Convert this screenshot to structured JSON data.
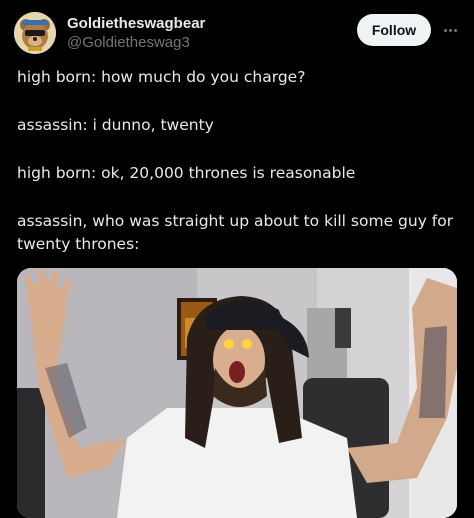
{
  "author": {
    "display_name": "Goldietheswagbear",
    "handle": "@Goldietheswag3",
    "avatar_icon": "bear-avatar-icon"
  },
  "actions": {
    "follow_label": "Follow",
    "more_icon": "more-options-icon"
  },
  "tweet": {
    "lines": [
      "high born: how much do you charge?",
      "assassin: i dunno, twenty",
      "high born: ok, 20,000 thrones is reasonable",
      "assassin, who was straight up about to kill some guy for twenty thrones:"
    ]
  },
  "media": {
    "type": "photo"
  },
  "colors": {
    "background": "#000000",
    "text": "#e7e9ea",
    "secondary_text": "#71767b",
    "follow_button_bg": "#eff3f4",
    "follow_button_text": "#0f1419"
  }
}
